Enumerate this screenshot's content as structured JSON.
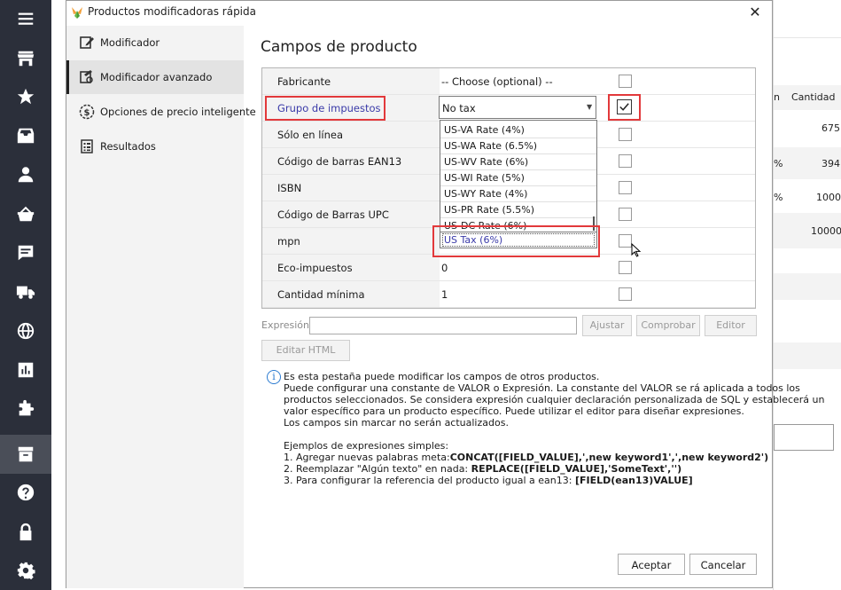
{
  "background_app": {
    "col_header_partial": "n",
    "col_cantidad": "Cantidad",
    "row_values": [
      "675",
      "394",
      "1000",
      "10000"
    ],
    "row_percents": [
      "%",
      "%"
    ]
  },
  "app_sidebar": {
    "icons": [
      "menu-icon",
      "store-icon",
      "star-icon",
      "inbox-icon",
      "user-icon",
      "basket-icon",
      "chat-icon",
      "truck-icon",
      "globe-icon",
      "chart-icon",
      "puzzle-icon",
      "box-icon",
      "help-icon",
      "lock-icon",
      "gear-icon"
    ]
  },
  "dialog": {
    "title": "Productos modificadoras rápida",
    "close_glyph": "✕",
    "nav": [
      {
        "label": "Modificador",
        "icon": "edit-icon"
      },
      {
        "label": "Modificador avanzado",
        "icon": "edit-advanced-icon"
      },
      {
        "label": "Opciones de precio inteligente",
        "icon": "dollar-icon"
      },
      {
        "label": "Resultados",
        "icon": "results-icon"
      }
    ],
    "heading": "Campos de producto",
    "fields": [
      {
        "label": "Fabricante",
        "value": "-- Choose (optional) --",
        "checked": false
      },
      {
        "label": "Grupo de impuestos",
        "value": "No tax",
        "checked": true
      },
      {
        "label": "Sólo en línea",
        "value": "",
        "checked": false
      },
      {
        "label": "Código de barras EAN13",
        "value": "",
        "checked": false
      },
      {
        "label": "ISBN",
        "value": "",
        "checked": false
      },
      {
        "label": "Código de Barras UPC",
        "value": "",
        "checked": false
      },
      {
        "label": "mpn",
        "value": "",
        "checked": false
      },
      {
        "label": "Eco-impuestos",
        "value": "0",
        "checked": false
      },
      {
        "label": "Cantidad mínima",
        "value": "1",
        "checked": false
      }
    ],
    "dropdown_options": [
      "US-VA Rate (4%)",
      "US-WA Rate (6.5%)",
      "US-WV Rate (6%)",
      "US-WI Rate (5%)",
      "US-WY Rate (4%)",
      "US-PR Rate (5.5%)",
      "US-DC Rate (6%)",
      "US Tax (6%)"
    ],
    "dropdown_selected": "US Tax (6%)",
    "expression_label": "Expresión",
    "expression_value": "",
    "buttons": {
      "ajustar": "Ajustar",
      "comprobar": "Comprobar",
      "editor": "Editor",
      "editar_html": "Editar HTML",
      "aceptar": "Aceptar",
      "cancelar": "Cancelar"
    },
    "info_glyph": "i",
    "info_lines": [
      "Es esta pestaña puede modificar los campos de otros productos.",
      "Puede configurar una constante de VALOR o Expresión. La constante del VALOR se rá aplicada a todos los",
      "productos seleccionados. Se considera expresión cualquier declaración personalizada de SQL y establecerá un",
      "valor específico para un producto específico. Puede utilizar el editor para diseñar expresiones.",
      "Los campos sin marcar no serán actualizados."
    ],
    "examples_title": "Ejemplos de expresiones simples:",
    "examples": [
      {
        "text": "1. Agregar nuevas palabras meta:",
        "code": "CONCAT([FIELD_VALUE],',new keyword1',',new keyword2')"
      },
      {
        "text": "2. Reemplazar \"Algún texto\" en nada:",
        "code": "REPLACE([FIELD_VALUE],'SomeText','')"
      },
      {
        "text": "3. Para configurar la referencia del producto igual a ean13:",
        "code": "[FIELD(ean13)VALUE]"
      }
    ]
  }
}
